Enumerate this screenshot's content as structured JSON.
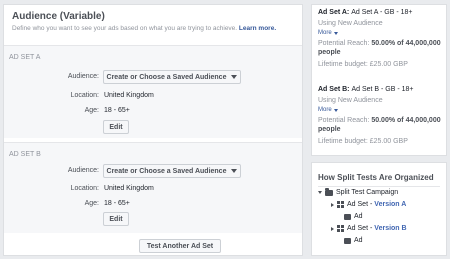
{
  "audience_panel": {
    "title": "Audience (Variable)",
    "description": "Define who you want to see your ads based on what you are trying to achieve.",
    "learn_more": "Learn more.",
    "adsets": [
      {
        "heading": "AD SET A",
        "audience_label": "Audience:",
        "audience_dropdown": "Create or Choose a Saved Audience",
        "location_label": "Location:",
        "location_value": "United Kingdom",
        "age_label": "Age:",
        "age_value": "18 - 65+",
        "edit_label": "Edit"
      },
      {
        "heading": "AD SET B",
        "audience_label": "Audience:",
        "audience_dropdown": "Create or Choose a Saved Audience",
        "location_label": "Location:",
        "location_value": "United Kingdom",
        "age_label": "Age:",
        "age_value": "18 - 65+",
        "edit_label": "Edit"
      }
    ],
    "test_another_label": "Test Another Ad Set"
  },
  "summaries": [
    {
      "title_bold": "Ad Set A:",
      "title_rest": "Ad Set A - GB - 18+",
      "using": "Using New Audience",
      "more": "More",
      "reach_label": "Potential Reach:",
      "reach_value": "50.00% of 44,000,000",
      "reach_unit": "people",
      "budget": "Lifetime budget: £25.00 GBP"
    },
    {
      "title_bold": "Ad Set B:",
      "title_rest": "Ad Set B - GB - 18+",
      "using": "Using New Audience",
      "more": "More",
      "reach_label": "Potential Reach:",
      "reach_value": "50.00% of 44,000,000",
      "reach_unit": "people",
      "budget": "Lifetime budget: £25.00 GBP"
    }
  ],
  "tree": {
    "title": "How Split Tests Are Organized",
    "campaign": "Split Test Campaign",
    "adset_label": "Ad Set -",
    "version_a": "Version A",
    "version_b": "Version B",
    "ad_label": "Ad"
  },
  "icons": {
    "caret": "caret-down-icon",
    "folder": "folder-icon",
    "adset": "grid-icon",
    "ad": "ad-icon"
  },
  "colors": {
    "link": "#365899",
    "version": "#4267b2",
    "background": "#e9ebee"
  }
}
